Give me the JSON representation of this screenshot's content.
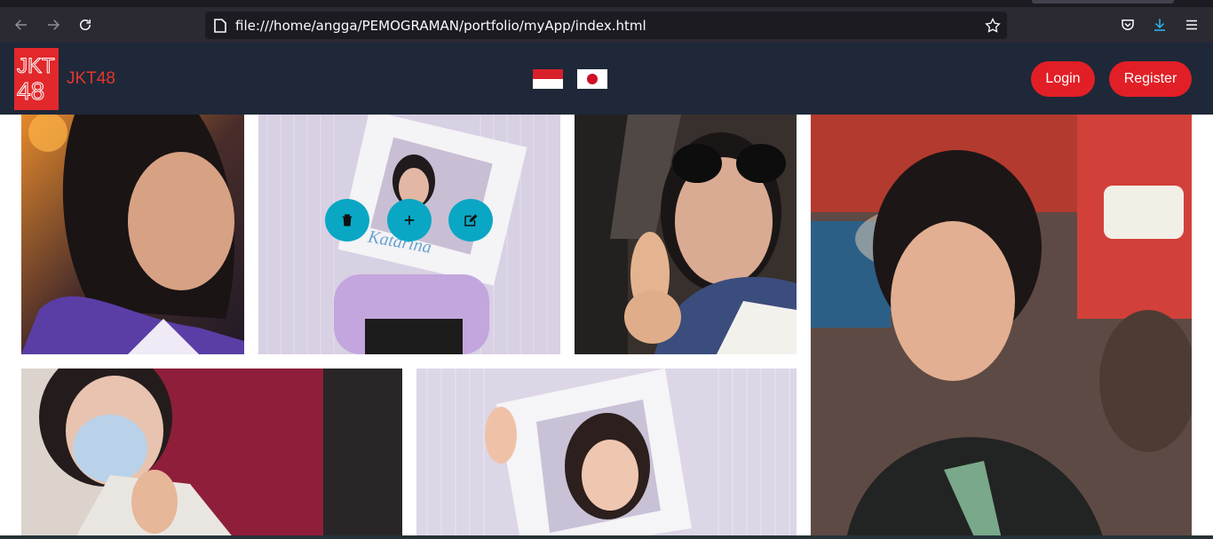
{
  "browser": {
    "url": "file:///home/angga/PEMOGRAMAN/portfolio/myApp/index.html",
    "icons": [
      "back-arrow-icon",
      "forward-arrow-icon",
      "reload-icon",
      "page-icon",
      "bookmark-star-icon",
      "pocket-icon",
      "download-icon",
      "menu-icon"
    ]
  },
  "site": {
    "logo_text_line1": "JKT",
    "logo_text_line2": "48",
    "brand": "JKT48",
    "languages": [
      "Indonesia flag",
      "Japan flag"
    ],
    "login_label": "Login",
    "register_label": "Register",
    "colors": {
      "navbar": "#1e2838",
      "accent_red": "#e21f26",
      "action_teal": "#0aa7c5"
    }
  },
  "gallery": {
    "photos": [
      {
        "name": "member-photo-1"
      },
      {
        "name": "member-photo-katarina"
      },
      {
        "name": "member-photo-3"
      },
      {
        "name": "member-photo-4"
      },
      {
        "name": "member-photo-5"
      },
      {
        "name": "member-photo-6"
      }
    ],
    "featured_caption": "Katarina",
    "overlay_actions": [
      "delete",
      "add",
      "edit"
    ]
  }
}
